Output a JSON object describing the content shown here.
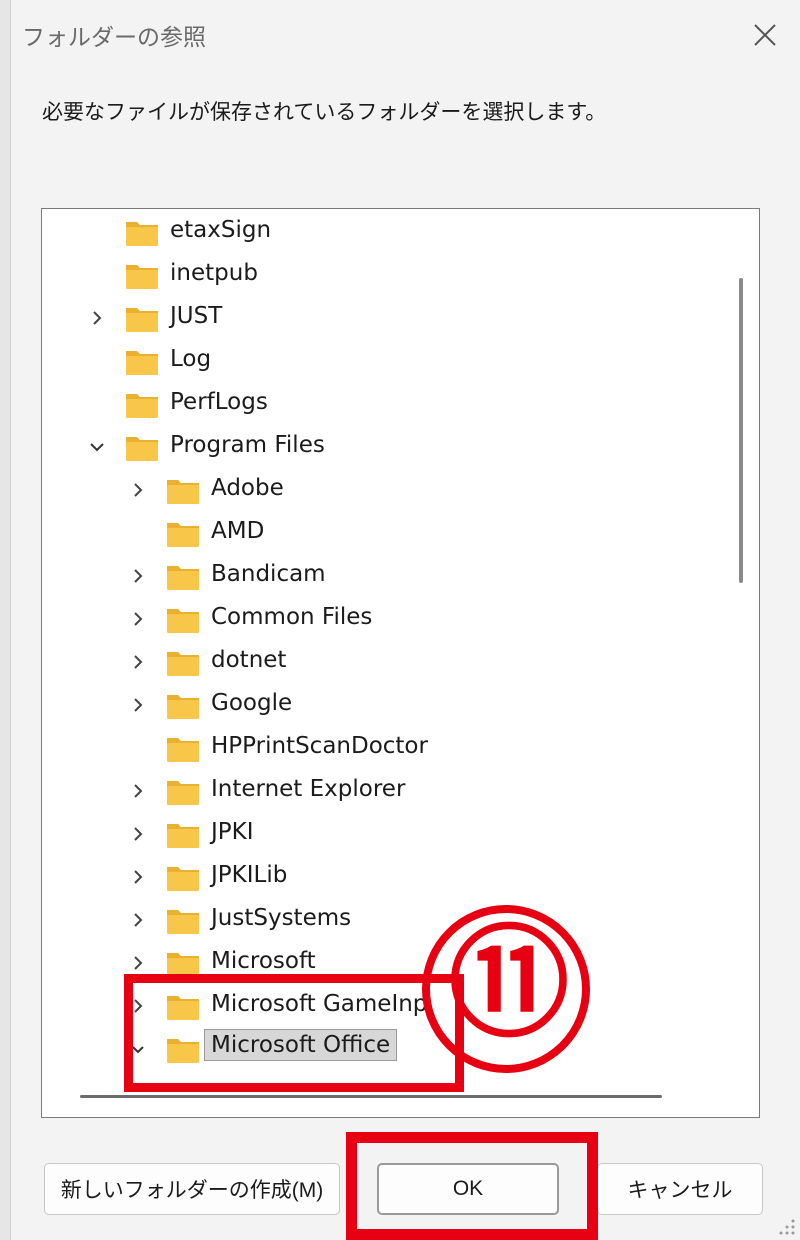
{
  "dialog": {
    "title": "フォルダーの参照",
    "instruction": "必要なファイルが保存されているフォルダーを選択します。"
  },
  "tree": {
    "items": [
      {
        "label": "etaxSign",
        "level": 0,
        "expandable": false
      },
      {
        "label": "inetpub",
        "level": 0,
        "expandable": false
      },
      {
        "label": "JUST",
        "level": 0,
        "expandable": true,
        "expanded": false
      },
      {
        "label": "Log",
        "level": 0,
        "expandable": false
      },
      {
        "label": "PerfLogs",
        "level": 0,
        "expandable": false
      },
      {
        "label": "Program Files",
        "level": 0,
        "expandable": true,
        "expanded": true
      },
      {
        "label": "Adobe",
        "level": 1,
        "expandable": true,
        "expanded": false
      },
      {
        "label": "AMD",
        "level": 1,
        "expandable": false
      },
      {
        "label": "Bandicam",
        "level": 1,
        "expandable": true,
        "expanded": false
      },
      {
        "label": "Common Files",
        "level": 1,
        "expandable": true,
        "expanded": false
      },
      {
        "label": "dotnet",
        "level": 1,
        "expandable": true,
        "expanded": false
      },
      {
        "label": "Google",
        "level": 1,
        "expandable": true,
        "expanded": false
      },
      {
        "label": "HPPrintScanDoctor",
        "level": 1,
        "expandable": false
      },
      {
        "label": "Internet Explorer",
        "level": 1,
        "expandable": true,
        "expanded": false
      },
      {
        "label": "JPKI",
        "level": 1,
        "expandable": true,
        "expanded": false
      },
      {
        "label": "JPKILib",
        "level": 1,
        "expandable": true,
        "expanded": false
      },
      {
        "label": "JustSystems",
        "level": 1,
        "expandable": true,
        "expanded": false
      },
      {
        "label": "Microsoft",
        "level": 1,
        "expandable": true,
        "expanded": false
      },
      {
        "label": "Microsoft GameInp",
        "level": 1,
        "expandable": true,
        "expanded": false,
        "partial": true
      },
      {
        "label": "Microsoft Office",
        "level": 1,
        "expandable": true,
        "expanded": true,
        "selected": true
      }
    ]
  },
  "annotation": {
    "step_number": "⑪",
    "color": "#e60012"
  },
  "buttons": {
    "new_folder": "新しいフォルダーの作成(M)",
    "ok": "OK",
    "cancel": "キャンセル"
  },
  "colors": {
    "folder_body": "#f8c74a",
    "folder_tab": "#eab02f",
    "selection": "#d7d7d7"
  }
}
